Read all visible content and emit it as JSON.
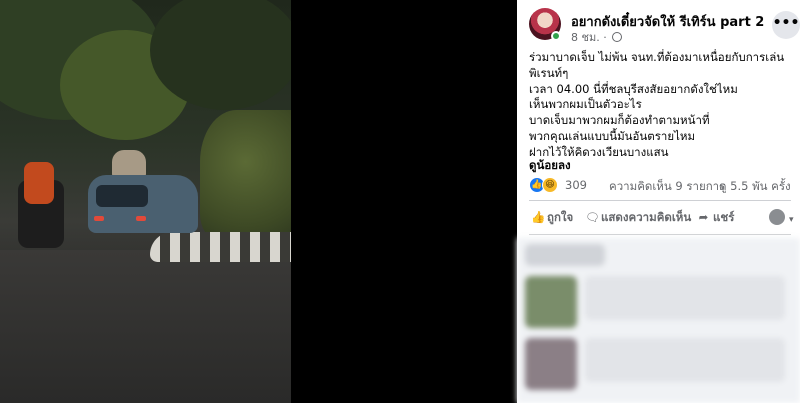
{
  "post": {
    "page_name": "อยากดังเดี๋ยวจัดให้ รีเทิร์น part 2",
    "time": "8 ชม. ·",
    "text_lines": [
      "ร่วมาบาดเจ็บ ไม่พ้น จนท.ที่ต้องมาเหนื่อยกับการเล่น",
      "พิเรนท์ๆ",
      "เวลา 04.00 นี่ที่ชลบุรีสงสัยอยากดังใช่ไหม",
      "เห็นพวกผมเป็นตัวอะไร",
      "บาดเจ็บมาพวกผมก็ต้องทำตามหน้าที่",
      "พวกคุณเล่นแบบนี้มันอันตรายไหม",
      "ฝากไว้ให้คิดวงเวียนบางแสน"
    ],
    "see_less": "ดูน้อยลง"
  },
  "stats": {
    "reaction_count": "309",
    "comments": "ความคิดเห็น 9 รายการ",
    "views": "ดู 5.5 พัน ครั้ง"
  },
  "actions": {
    "like": "ถูกใจ",
    "comment": "แสดงความคิดเห็น",
    "share": "แชร์"
  },
  "icons": {
    "more": "ellipsis-icon",
    "privacy": "globe-icon",
    "like_reaction": "like-reaction-icon",
    "haha_reaction": "haha-reaction-icon"
  },
  "colors": {
    "accent": "#1877f2",
    "online": "#31a24c",
    "secondary_text": "#65676b"
  }
}
